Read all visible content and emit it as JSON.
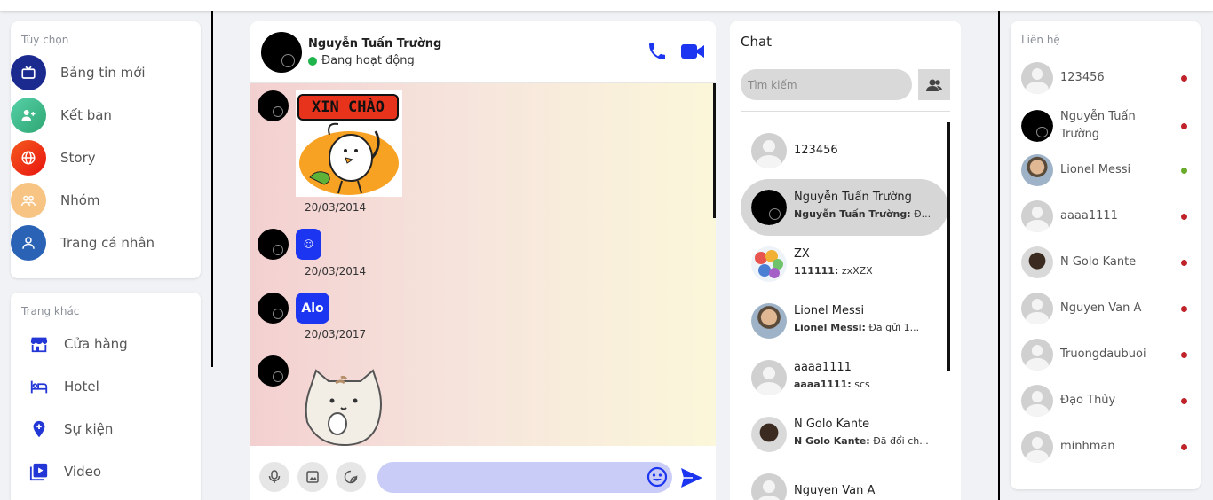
{
  "options": {
    "title": "Tùy chọn",
    "items": [
      {
        "label": "Bảng tin mới",
        "icon": "tv-icon",
        "color": "#1a2a8f"
      },
      {
        "label": "Kết bạn",
        "icon": "add-friend-icon",
        "color": "#3fb98a"
      },
      {
        "label": "Story",
        "icon": "globe-icon",
        "color": "#f23a1e"
      },
      {
        "label": "Nhóm",
        "icon": "group-icon",
        "color": "#f7b26a"
      },
      {
        "label": "Trang cá nhân",
        "icon": "user-icon",
        "color": "#2a62b6"
      }
    ]
  },
  "other_pages": {
    "title": "Trang khác",
    "items": [
      {
        "label": "Cửa hàng",
        "icon": "store-icon"
      },
      {
        "label": "Hotel",
        "icon": "bed-icon"
      },
      {
        "label": "Sự kiện",
        "icon": "location-plus-icon"
      },
      {
        "label": "Video",
        "icon": "video-play-icon"
      }
    ]
  },
  "conversation": {
    "name": "Nguyễn Tuấn Trường",
    "status": "Đang hoạt động",
    "status_color": "#1fb34b",
    "accent": "#1c35f0",
    "messages": [
      {
        "type": "sticker",
        "sticker_text": "XIN CHÀO",
        "date": "20/03/2014"
      },
      {
        "type": "emoji",
        "text": "☺",
        "date": "20/03/2014"
      },
      {
        "type": "text",
        "text": "Alo",
        "date": "20/03/2017"
      },
      {
        "type": "sticker",
        "sticker_text": "",
        "date": ""
      }
    ]
  },
  "chat": {
    "title": "Chat",
    "search_placeholder": "Tìm kiếm",
    "rows": [
      {
        "name": "123456",
        "sender": "",
        "last": "",
        "avatar": "placeholder"
      },
      {
        "name": "Nguyễn Tuấn Trường",
        "sender": "Nguyễn Tuấn Trường:",
        "last": "Đ...",
        "avatar": "black",
        "active": true
      },
      {
        "name": "ZX",
        "sender": "111111:",
        "last": "zxXZX",
        "avatar": "group"
      },
      {
        "name": "Lionel Messi",
        "sender": "Lionel Messi:",
        "last": "Đã gửi 1...",
        "avatar": "photo"
      },
      {
        "name": "aaaa1111",
        "sender": "aaaa1111:",
        "last": "scs",
        "avatar": "placeholder"
      },
      {
        "name": "N Golo Kante",
        "sender": "N Golo Kante:",
        "last": "Đã đổi ch...",
        "avatar": "photo-dark"
      },
      {
        "name": "Nguyen Van A",
        "sender": "",
        "last": "",
        "avatar": "placeholder"
      }
    ]
  },
  "contacts": {
    "title": "Liên hệ",
    "online_color": "#6aaa2a",
    "offline_color": "#c0222a",
    "items": [
      {
        "name": "123456",
        "avatar": "placeholder",
        "online": false
      },
      {
        "name": "Nguyễn Tuấn Trường",
        "avatar": "black",
        "online": false
      },
      {
        "name": "Lionel Messi",
        "avatar": "photo",
        "online": true
      },
      {
        "name": "aaaa1111",
        "avatar": "placeholder",
        "online": false
      },
      {
        "name": "N Golo Kante",
        "avatar": "photo-dark",
        "online": false
      },
      {
        "name": "Nguyen Van A",
        "avatar": "placeholder",
        "online": false
      },
      {
        "name": "Truongdaubuoi",
        "avatar": "placeholder",
        "online": false
      },
      {
        "name": "Đạo Thủy",
        "avatar": "placeholder",
        "online": false
      },
      {
        "name": "minhman",
        "avatar": "placeholder",
        "online": false
      }
    ]
  }
}
